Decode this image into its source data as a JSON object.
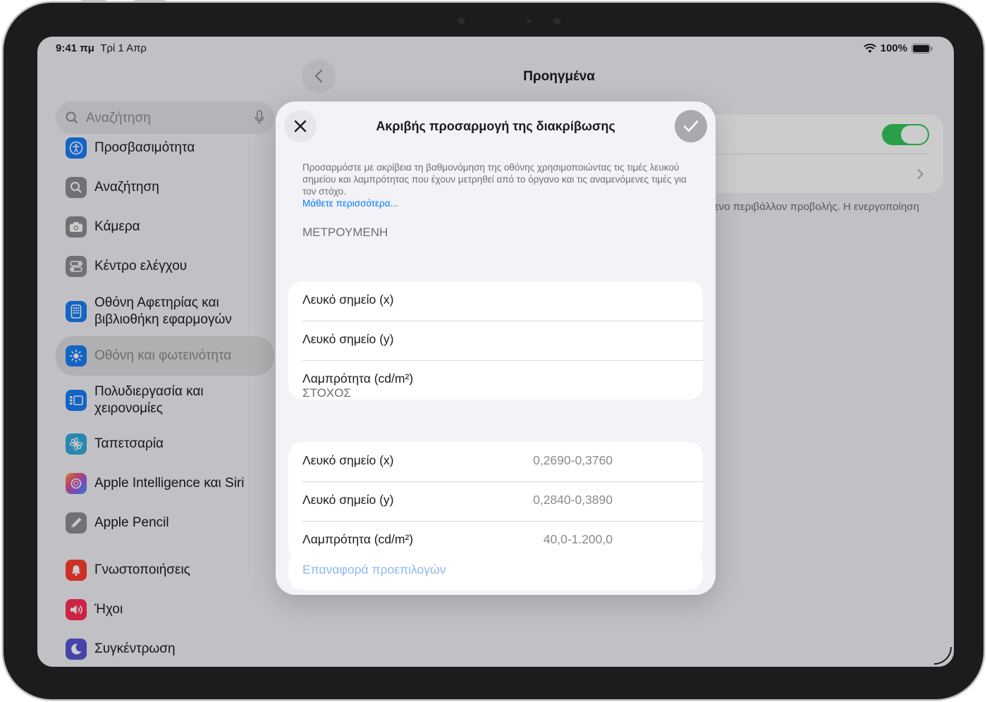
{
  "status": {
    "time": "9:41 πμ",
    "date": "Τρί 1 Απρ",
    "battery": "100%"
  },
  "sidebar": {
    "search_placeholder": "Αναζήτηση",
    "items": [
      {
        "label": "Προσβασιμότητα",
        "icon": "accessibility-icon",
        "color": "#1a7ef5"
      },
      {
        "label": "Αναζήτηση",
        "icon": "search-icon",
        "color": "#8e8e93"
      },
      {
        "label": "Κάμερα",
        "icon": "camera-icon",
        "color": "#8e8e93"
      },
      {
        "label": "Κέντρο ελέγχου",
        "icon": "control-center-icon",
        "color": "#8e8e93"
      },
      {
        "label": "Οθόνη Αφετηρίας και βιβλιοθήκη εφαρμογών",
        "icon": "home-screen-icon",
        "color": "#1a7ef5"
      },
      {
        "label": "Οθόνη και φωτεινότητα",
        "icon": "brightness-icon",
        "color": "#1a7ef5",
        "selected": true
      },
      {
        "label": "Πολυδιεργασία και χειρονομίες",
        "icon": "multitasking-icon",
        "color": "#1a7ef5"
      },
      {
        "label": "Ταπετσαρία",
        "icon": "wallpaper-icon",
        "color": "#35aadc"
      },
      {
        "label": "Apple Intelligence και Siri",
        "icon": "siri-icon",
        "color": "#d9608c"
      },
      {
        "label": "Apple Pencil",
        "icon": "pencil-icon",
        "color": "#8e8e93"
      },
      {
        "label": "Γνωστοποιήσεις",
        "icon": "bell-icon",
        "color": "#ff3b30"
      },
      {
        "label": "Ήχοι",
        "icon": "speaker-icon",
        "color": "#ff2d55"
      },
      {
        "label": "Συγκέντρωση",
        "icon": "moon-icon",
        "color": "#5856d6"
      }
    ]
  },
  "detail": {
    "title": "Προηγμένα",
    "partial_text": "ενο περιβάλλον προβολής. Η ενεργοποίηση"
  },
  "modal": {
    "title": "Ακριβής προσαρμογή της διακρίβωσης",
    "description": "Προσαρμόστε με ακρίβεια τη βαθμονόμηση της οθόνης χρησιμοποιώντας τις τιμές λευκού σημείου και λαμπρότητας που έχουν μετρηθεί από το όργανο και τις αναμενόμενες τιμές για τον στόχο.",
    "learn_more": "Μάθετε περισσότερα...",
    "measured_header": "ΜΕΤΡΟΥΜΕΝΗ",
    "measured": [
      {
        "label": "Λευκό σημείο (x)"
      },
      {
        "label": "Λευκό σημείο (y)"
      },
      {
        "label": "Λαμπρότητα (cd/m²)"
      }
    ],
    "target_header": "ΣΤΟΧΟΣ",
    "target": [
      {
        "label": "Λευκό σημείο (x)",
        "value": "0,2690-0,3760"
      },
      {
        "label": "Λευκό σημείο (y)",
        "value": "0,2840-0,3890"
      },
      {
        "label": "Λαμπρότητα (cd/m²)",
        "value": "40,0-1.200,0"
      }
    ],
    "reset_label": "Επαναφορά προεπιλογών"
  }
}
